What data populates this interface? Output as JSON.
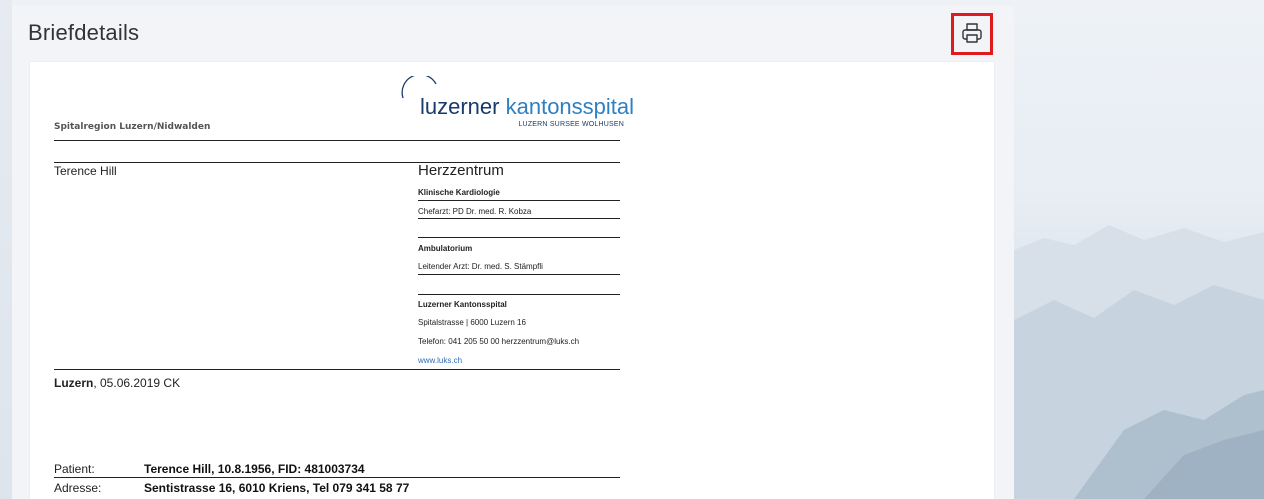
{
  "panel": {
    "title": "Briefdetails"
  },
  "toolbar": {
    "print_icon": "printer-icon"
  },
  "letter": {
    "org_region": "Spitalregion Luzern/Nidwalden",
    "logo": {
      "name_part1": "luzerner",
      "name_part2": "kantonsspital",
      "subtitle": "LUZERN SURSEE WOLHUSEN"
    },
    "recipient": "Terence Hill",
    "department": "Herzzentrum",
    "unit": "Klinische Kardiologie",
    "chief": "Chefarzt: PD Dr. med. R. Kobza",
    "ambulatorium": "Ambulatorium",
    "leading_doctor": "Leitender Arzt: Dr. med. S. Stämpfli",
    "institution": "Luzerner Kantonsspital",
    "address": "Spitalstrasse | 6000 Luzern 16",
    "phone": "Telefon: 041 205 50 00 herzzentrum@luks.ch",
    "website": "www.luks.ch",
    "place": "Luzern",
    "date_line": ", 05.06.2019 CK",
    "patient_label": "Patient:",
    "patient_value": "Terence Hill, 10.8.1956, FID: 481003734",
    "address_label": "Adresse:",
    "address_value": "Sentistrasse 16, 6010 Kriens, Tel 079 341 58 77"
  },
  "colors": {
    "highlight_border": "#e01b1b",
    "logo_dark": "#1a3a6b",
    "logo_blue": "#2f7fc1"
  }
}
